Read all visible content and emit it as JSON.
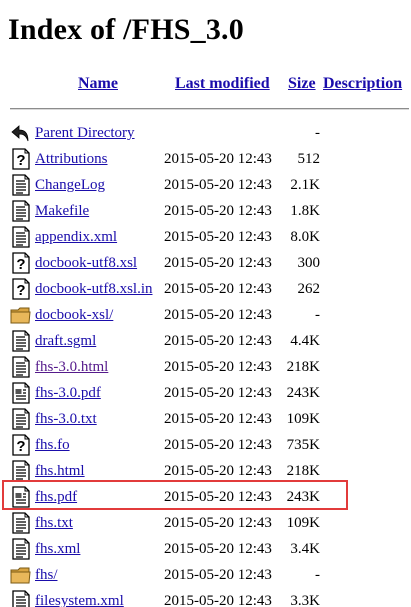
{
  "page": {
    "title": "Index of /FHS_3.0"
  },
  "columns": {
    "name": "Name",
    "last_modified": "Last modified",
    "size": "Size",
    "description": "Description"
  },
  "rows": [
    {
      "name": "Parent Directory",
      "date": "",
      "size": "-",
      "icon": "back-arrow-icon",
      "visited": false
    },
    {
      "name": "Attributions",
      "date": "2015-05-20 12:43",
      "size": "512",
      "icon": "unknown-file-icon",
      "visited": false
    },
    {
      "name": "ChangeLog",
      "date": "2015-05-20 12:43",
      "size": "2.1K",
      "icon": "text-file-icon",
      "visited": false
    },
    {
      "name": "Makefile",
      "date": "2015-05-20 12:43",
      "size": "1.8K",
      "icon": "text-file-icon",
      "visited": false
    },
    {
      "name": "appendix.xml",
      "date": "2015-05-20 12:43",
      "size": "8.0K",
      "icon": "text-file-icon",
      "visited": false
    },
    {
      "name": "docbook-utf8.xsl",
      "date": "2015-05-20 12:43",
      "size": "300",
      "icon": "unknown-file-icon",
      "visited": false
    },
    {
      "name": "docbook-utf8.xsl.in",
      "date": "2015-05-20 12:43",
      "size": "262",
      "icon": "unknown-file-icon",
      "visited": false
    },
    {
      "name": "docbook-xsl/",
      "date": "2015-05-20 12:43",
      "size": "-",
      "icon": "folder-icon",
      "visited": false
    },
    {
      "name": "draft.sgml",
      "date": "2015-05-20 12:43",
      "size": "4.4K",
      "icon": "text-file-icon",
      "visited": false
    },
    {
      "name": "fhs-3.0.html",
      "date": "2015-05-20 12:43",
      "size": "218K",
      "icon": "text-file-icon",
      "visited": true
    },
    {
      "name": "fhs-3.0.pdf",
      "date": "2015-05-20 12:43",
      "size": "243K",
      "icon": "layout-file-icon",
      "visited": false
    },
    {
      "name": "fhs-3.0.txt",
      "date": "2015-05-20 12:43",
      "size": "109K",
      "icon": "text-file-icon",
      "visited": false
    },
    {
      "name": "fhs.fo",
      "date": "2015-05-20 12:43",
      "size": "735K",
      "icon": "unknown-file-icon",
      "visited": false
    },
    {
      "name": "fhs.html",
      "date": "2015-05-20 12:43",
      "size": "218K",
      "icon": "text-file-icon",
      "visited": false
    },
    {
      "name": "fhs.pdf",
      "date": "2015-05-20 12:43",
      "size": "243K",
      "icon": "layout-file-icon",
      "visited": false
    },
    {
      "name": "fhs.txt",
      "date": "2015-05-20 12:43",
      "size": "109K",
      "icon": "text-file-icon",
      "visited": false
    },
    {
      "name": "fhs.xml",
      "date": "2015-05-20 12:43",
      "size": "3.4K",
      "icon": "text-file-icon",
      "visited": false
    },
    {
      "name": "fhs/",
      "date": "2015-05-20 12:43",
      "size": "-",
      "icon": "folder-icon",
      "visited": false
    },
    {
      "name": "filesystem.xml",
      "date": "2015-05-20 12:43",
      "size": "3.3K",
      "icon": "text-file-icon",
      "visited": false
    }
  ],
  "highlight": {
    "row": "fhs.pdf",
    "color": "#e23b3b"
  },
  "colors": {
    "link": "#1a0dab",
    "visited_link": "#551a8b",
    "folder": "#d9a441"
  }
}
